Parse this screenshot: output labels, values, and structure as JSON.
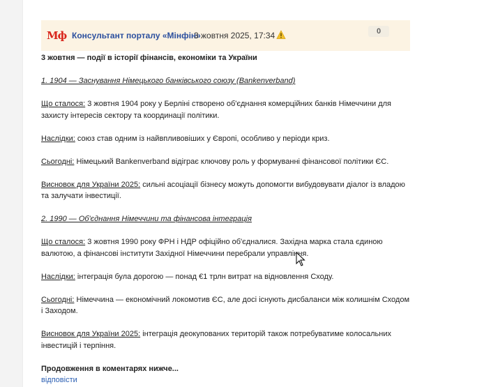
{
  "post": {
    "logo_text": "Мф",
    "author": "Консультант порталу «Мінфін»",
    "date": "3 жовтня 2025, 17:34",
    "warning_icon": "warning-icon",
    "score": "0"
  },
  "content": {
    "title": "3 жовтня — події в історії фінансів, економіки та України",
    "event1_heading": "1. 1904 — Заснування Німецького банківського союзу (Bankenverband)",
    "event1_what_label": "Що сталося:",
    "event1_what_text": " 3 жовтня 1904 року у Берліні створено об'єднання комерційних банків Німеччини для захисту інтересів сектору та координації політики.",
    "event1_result_label": "Наслідки:",
    "event1_result_text": " союз став одним із найвпливовіших у Європі, особливо у періоди криз.",
    "event1_today_label": "Сьогодні:",
    "event1_today_text": " Німецький Bankenverband відіграє ключову роль у формуванні фінансової політики ЄС.",
    "event1_conclusion_label": "Висновок для України 2025:",
    "event1_conclusion_text": " сильні асоціації бізнесу можуть допомогти вибудовувати діалог із владою та залучати інвестиції.",
    "event2_heading": "2. 1990 — Об'єднання Німеччини та фінансова інтеграція",
    "event2_what_label": "Що сталося:",
    "event2_what_text": " 3 жовтня 1990 року ФРН і НДР офіційно об'єдналися. Західна марка стала єдиною валютою, а фінансові інститути Західної Німеччини перебрали управління.",
    "event2_result_label": "Наслідки:",
    "event2_result_text": " інтеграція була дорогою — понад €1 трлн витрат на відновлення Сходу.",
    "event2_today_label": "Сьогодні:",
    "event2_today_text": " Німеччина — економічний локомотив ЄС, але досі існують дисбаланси між колишнім Сходом і Заходом.",
    "event2_conclusion_label": "Висновок для України 2025:",
    "event2_conclusion_text": " інтеграція деокупованих територій також потребуватиме колосальних інвестицій і терпіння.",
    "continuation": "Продовження в коментарях нижче..."
  },
  "actions": {
    "reply": "відповісти"
  }
}
